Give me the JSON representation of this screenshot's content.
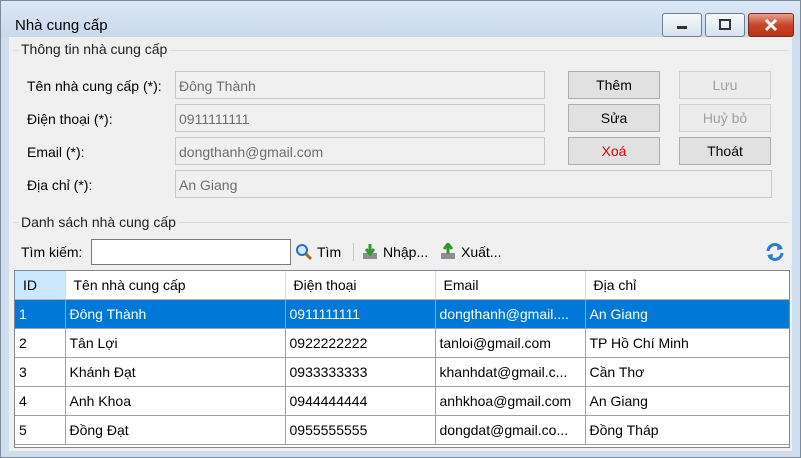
{
  "window": {
    "title": "Nhà cung cấp"
  },
  "info_group": {
    "label": "Thông tin nhà cung cấp"
  },
  "form": {
    "name_label": "Tên nhà cung cấp (*):",
    "name_value": "Đông Thành",
    "phone_label": "Điện thoại (*):",
    "phone_value": "0911111111",
    "email_label": "Email (*):",
    "email_value": "dongthanh@gmail.com",
    "address_label": "Địa chỉ (*):",
    "address_value": "An Giang"
  },
  "buttons": {
    "add": "Thêm",
    "save": "Lưu",
    "edit": "Sửa",
    "cancel": "Huỷ bỏ",
    "delete": "Xoá",
    "exit": "Thoát"
  },
  "list_group": {
    "label": "Danh sách nhà cung cấp"
  },
  "toolbar": {
    "search_label": "Tìm kiếm:",
    "search_value": "",
    "find": "Tìm",
    "import": "Nhập...",
    "export": "Xuất..."
  },
  "table": {
    "headers": [
      "ID",
      "Tên nhà cung cấp",
      "Điện thoại",
      "Email",
      "Địa chỉ"
    ],
    "rows": [
      [
        "1",
        "Đông Thành",
        "0911111111",
        "dongthanh@gmail....",
        "An Giang"
      ],
      [
        "2",
        "Tân Lợi",
        "0922222222",
        "tanloi@gmail.com",
        "TP Hồ Chí Minh"
      ],
      [
        "3",
        "Khánh Đạt",
        "0933333333",
        "khanhdat@gmail.c...",
        "Cần Thơ"
      ],
      [
        "4",
        "Anh Khoa",
        "0944444444",
        "anhkhoa@gmail.com",
        "An Giang"
      ],
      [
        "5",
        "Đồng Đạt",
        "0955555555",
        "dongdat@gmail.co...",
        "Đồng Tháp"
      ]
    ],
    "selected_row": 0
  },
  "colors": {
    "selection": "#0078d7",
    "delete_text": "#e00000",
    "header_selected": "#cce8ff"
  },
  "icons": {
    "search": "magnifier-icon",
    "import": "import-icon",
    "export": "export-icon",
    "refresh": "refresh-icon"
  }
}
